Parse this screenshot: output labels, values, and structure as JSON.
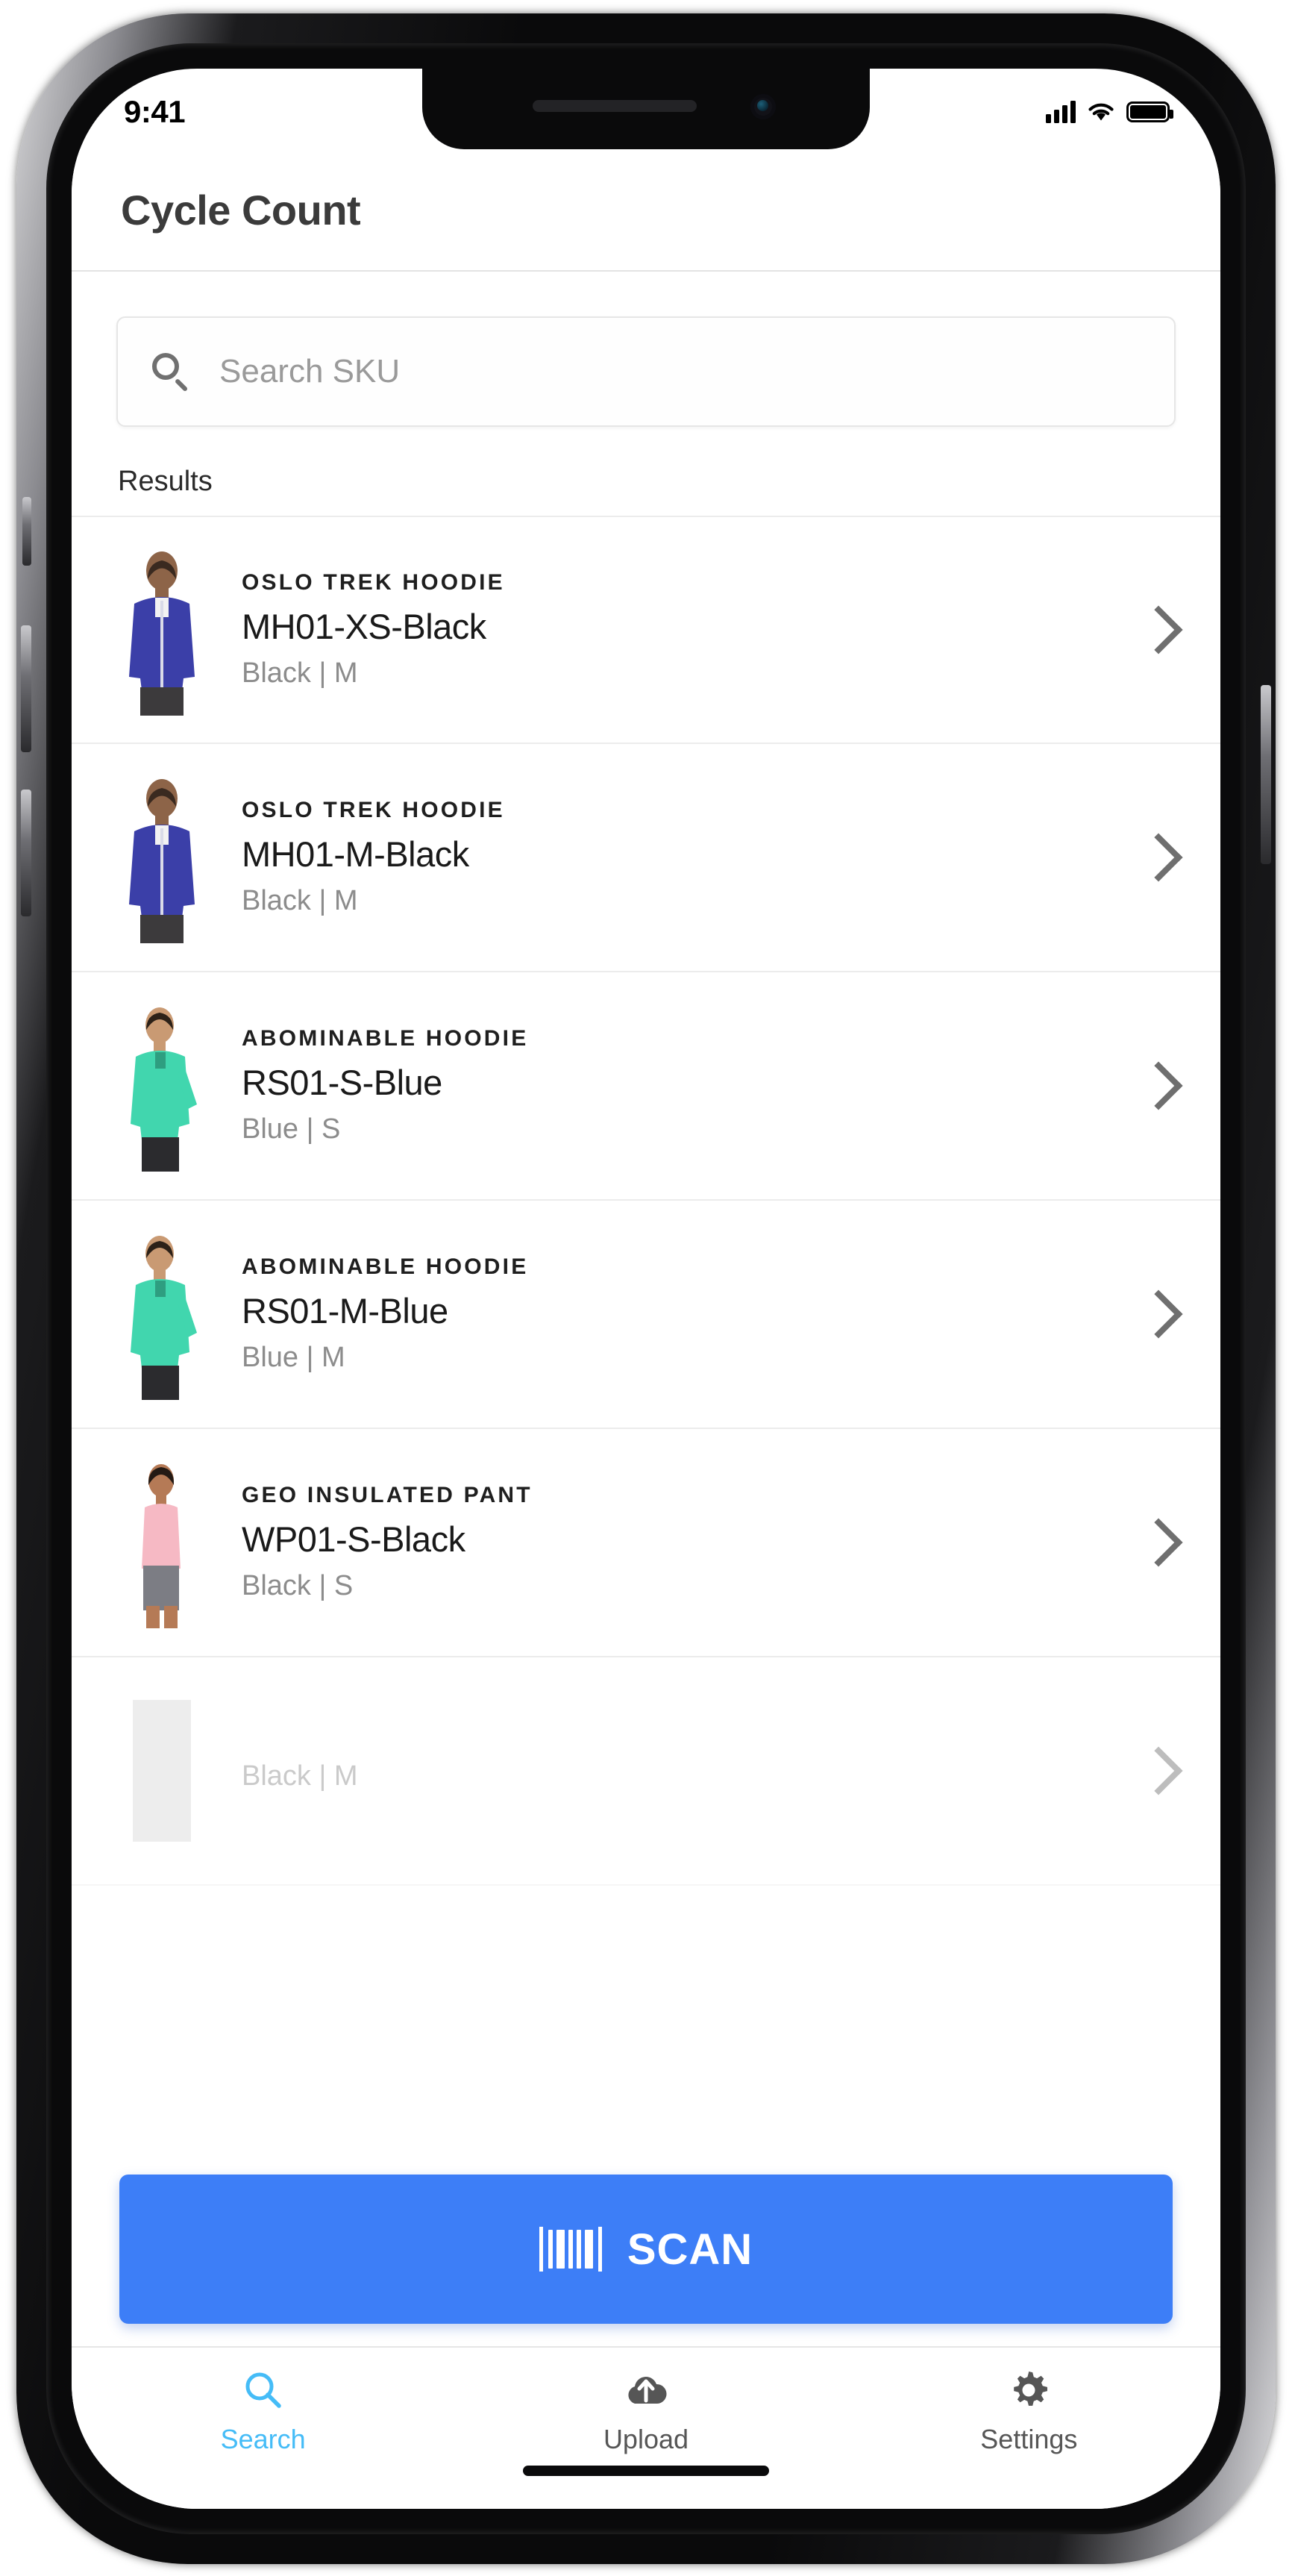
{
  "device": {
    "status_bar": {
      "time": "9:41",
      "signal_icon": "cellular-signal-icon",
      "wifi_icon": "wifi-icon",
      "battery_icon": "battery-full-icon"
    },
    "home_indicator": "home-indicator"
  },
  "header": {
    "title": "Cycle Count"
  },
  "search": {
    "icon": "search-icon",
    "placeholder": "Search SKU",
    "value": ""
  },
  "results": {
    "label": "Results",
    "items": [
      {
        "brand": "OSLO TREK HOODIE",
        "sku": "MH01-XS-Black",
        "attrs": "Black | M",
        "thumb_color": "#3b3fa8",
        "thumb_alt": "male-model-blue-hoodie",
        "chevron": "chevron-right-icon"
      },
      {
        "brand": "OSLO TREK HOODIE",
        "sku": "MH01-M-Black",
        "attrs": "Black | M",
        "thumb_color": "#3b3fa8",
        "thumb_alt": "male-model-blue-hoodie",
        "chevron": "chevron-right-icon"
      },
      {
        "brand": "ABOMINABLE HOODIE",
        "sku": "RS01-S-Blue",
        "attrs": "Blue | S",
        "thumb_color": "#41d6ae",
        "thumb_alt": "female-model-teal-top",
        "chevron": "chevron-right-icon"
      },
      {
        "brand": "ABOMINABLE HOODIE",
        "sku": "RS01-M-Blue",
        "attrs": "Blue | M",
        "thumb_color": "#41d6ae",
        "thumb_alt": "female-model-teal-top",
        "chevron": "chevron-right-icon"
      },
      {
        "brand": "GEO INSULATED PANT",
        "sku": "WP01-S-Black",
        "attrs": "Black | S",
        "thumb_color": "#f6b9c4",
        "thumb_alt": "female-model-pink-tank",
        "chevron": "chevron-right-icon"
      },
      {
        "brand": "",
        "sku": "",
        "attrs": "Black | M",
        "thumb_color": "#cfcfcf",
        "thumb_alt": "partially-hidden-thumbnail",
        "chevron": "chevron-right-icon"
      }
    ]
  },
  "scan": {
    "label": "SCAN",
    "icon": "barcode-icon",
    "color": "#3d7ef7"
  },
  "tab_bar": {
    "active_color": "#45bcf7",
    "inactive_color": "#565656",
    "tabs": [
      {
        "label": "Search",
        "icon": "search-icon",
        "active": true
      },
      {
        "label": "Upload",
        "icon": "cloud-upload-icon",
        "active": false
      },
      {
        "label": "Settings",
        "icon": "gear-icon",
        "active": false
      }
    ]
  }
}
